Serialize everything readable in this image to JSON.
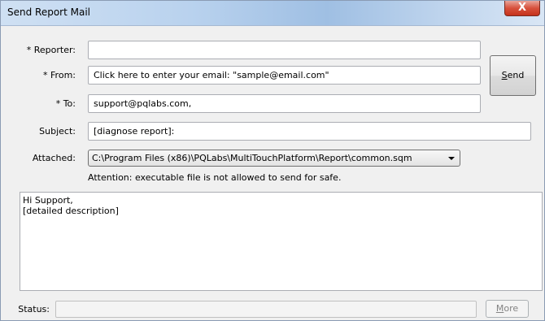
{
  "window": {
    "title": "Send Report Mail",
    "close_label": "X"
  },
  "form": {
    "reporter_label": "* Reporter:",
    "reporter_value": "",
    "from_label": "* From:",
    "from_value": "Click here to enter your email: \"sample@email.com\"",
    "to_label": "* To:",
    "to_value": "support@pqlabs.com,",
    "subject_label": "Subject:",
    "subject_value": "[diagnose report]:",
    "attached_label": "Attached:",
    "attached_value": "C:\\Program Files (x86)\\PQLabs\\MultiTouchPlatform\\Report\\common.sqm",
    "attention": "Attention: executable file is not allowed to send for safe."
  },
  "buttons": {
    "send_mnemonic": "S",
    "send_rest": "end",
    "more_mnemonic": "M",
    "more_rest": "ore"
  },
  "message": {
    "body": "Hi Support,\n[detailed description]"
  },
  "status": {
    "label": "Status:",
    "value": ""
  }
}
